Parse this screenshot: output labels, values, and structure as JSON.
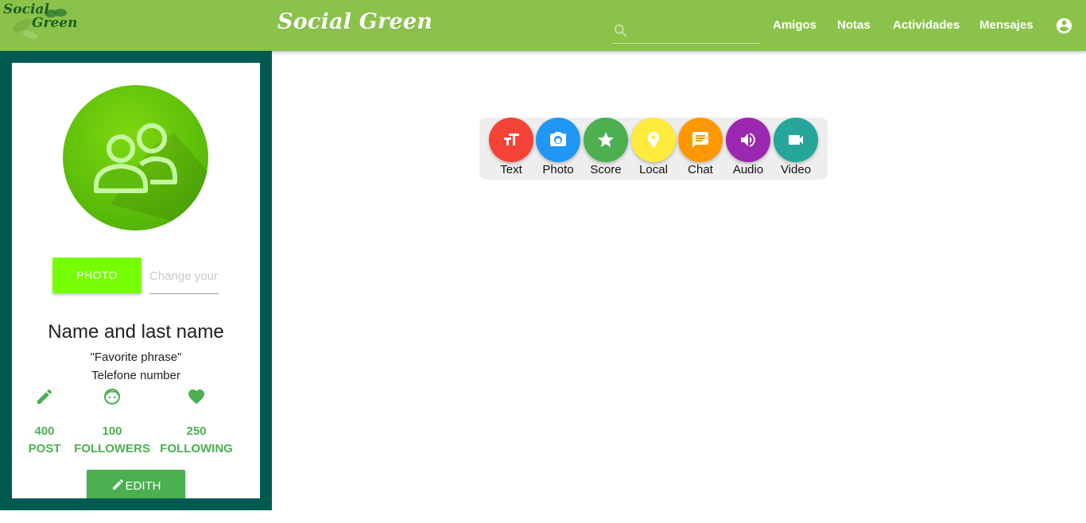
{
  "header": {
    "logo_line1": "Social",
    "logo_line2": "Green",
    "brand": "Social Green",
    "search_placeholder": "",
    "nav": [
      "Amigos",
      "Notas",
      "Actividades",
      "Mensajes"
    ],
    "account_icon": "account-circle-icon",
    "color": "#8bc34a"
  },
  "profile": {
    "avatar_icon": "group-icon",
    "photo_button": "PHOTO",
    "change_placeholder": "Change your",
    "name": "Name and last name",
    "phrase": "\"Favorite phrase\"",
    "phone": "Telefone number",
    "stats": [
      {
        "icon": "pencil-icon",
        "value": "400",
        "label": "POST"
      },
      {
        "icon": "face-icon",
        "value": "100",
        "label": "FOLLOWERS"
      },
      {
        "icon": "heart-icon",
        "value": "250",
        "label": "FOLLOWING"
      }
    ],
    "edit_button": "EDITH",
    "sidebar_color": "#005a52",
    "accent": "#4caf50"
  },
  "toolbar": {
    "items": [
      {
        "label": "Text",
        "icon": "text-size-icon",
        "color": "#f44336"
      },
      {
        "label": "Photo",
        "icon": "camera-icon",
        "color": "#2196f3"
      },
      {
        "label": "Score",
        "icon": "star-icon",
        "color": "#4caf50"
      },
      {
        "label": "Local",
        "icon": "location-pin-icon",
        "color": "#ffeb3b"
      },
      {
        "label": "Chat",
        "icon": "chat-icon",
        "color": "#ff9800"
      },
      {
        "label": "Audio",
        "icon": "volume-icon",
        "color": "#9c27b0"
      },
      {
        "label": "Video",
        "icon": "videocam-icon",
        "color": "#26a69a"
      }
    ]
  }
}
